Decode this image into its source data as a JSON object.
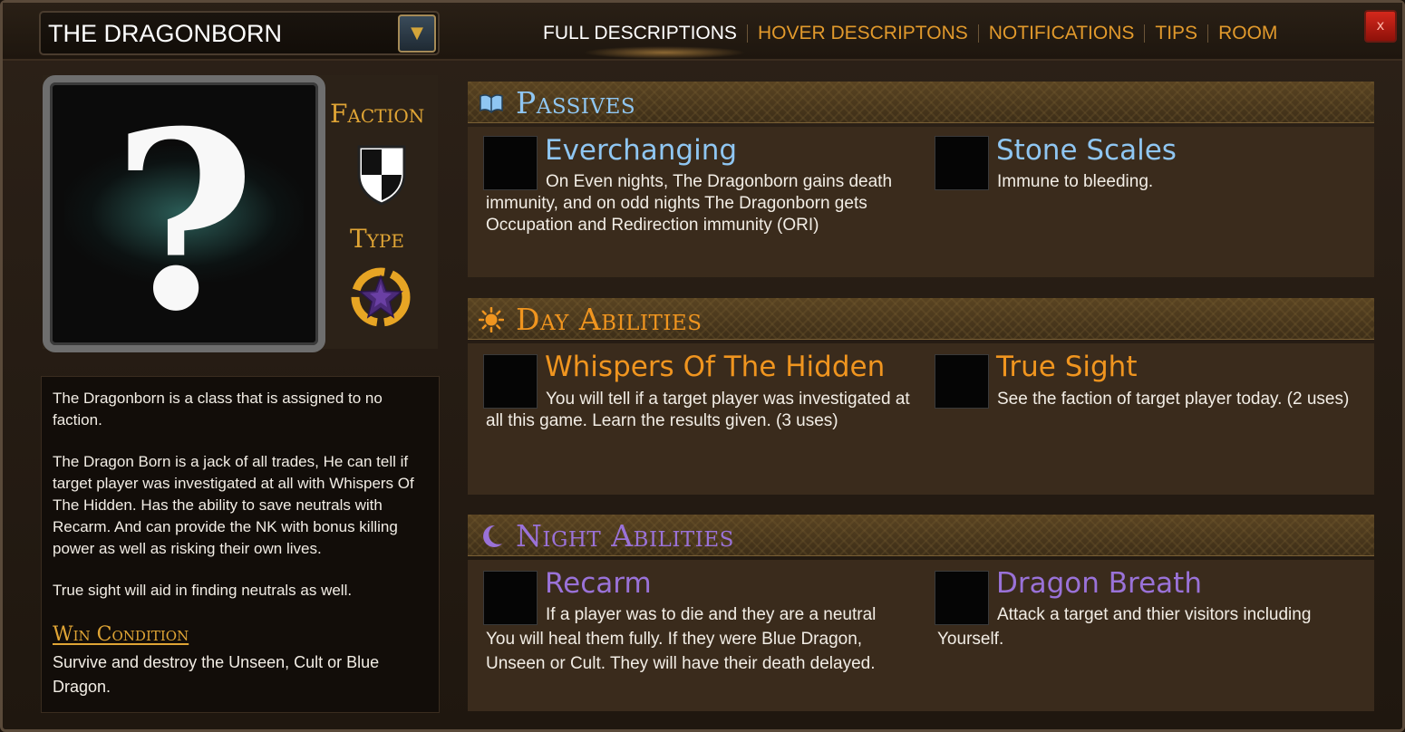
{
  "header": {
    "role_name": "THE DRAGONBORN",
    "dropdown_arrow": "▼",
    "tabs": [
      {
        "label": "FULL DESCRIPTIONS",
        "active": true
      },
      {
        "label": "HOVER DESCRIPTONS",
        "active": false
      },
      {
        "label": "NOTIFICATIONS",
        "active": false
      },
      {
        "label": "TIPS",
        "active": false
      },
      {
        "label": "ROOM",
        "active": false
      }
    ],
    "close_label": "x"
  },
  "portrait": {
    "symbol": "?"
  },
  "sidebar": {
    "faction_label": "Faction",
    "type_label": "Type",
    "faction_icon": "shield-checkered-icon",
    "type_icon": "purple-star-ring-icon"
  },
  "description": {
    "paragraphs": [
      "The Dragonborn is a class that is assigned to no faction.",
      "The Dragon Born is a jack of all trades, He can tell if target player was investigated at all with Whispers Of The Hidden. Has the ability to save neutrals with Recarm. And can provide the NK with bonus killing power as well as risking their own lives.",
      "True sight will aid in finding neutrals as well."
    ],
    "win_condition_title": "Win Condition",
    "win_condition_text": "Survive and destroy the Unseen, Cult or Blue Dragon."
  },
  "sections": {
    "passives": {
      "title": "Passives",
      "color": "#8fc6f2",
      "icon": "book-icon",
      "abilities": [
        {
          "name": "Everchanging",
          "desc": "On Even nights, The Dragonborn gains death immunity, and on odd nights The Dragonborn gets Occupation and Redirection immunity (ORI)"
        },
        {
          "name": "Stone Scales",
          "desc": "Immune to bleeding."
        }
      ]
    },
    "day": {
      "title": "Day Abilities",
      "color": "#f0951f",
      "icon": "sun-icon",
      "abilities": [
        {
          "name": "Whispers Of The Hidden",
          "desc": "You will tell if a target player was investigated at all this game. Learn the results given. (3 uses)"
        },
        {
          "name": "True Sight",
          "desc": "See the faction of target player today. (2 uses)"
        }
      ]
    },
    "night": {
      "title": "Night Abilities",
      "color": "#9a72d8",
      "icon": "moon-icon",
      "abilities": [
        {
          "name": "Recarm",
          "desc": "If a player was to die and they are a neutral You will heal them fully. If they were Blue Dragon, Unseen or Cult. They will have their death delayed."
        },
        {
          "name": "Dragon Breath",
          "desc": "Attack a target and thier visitors including Yourself."
        }
      ]
    }
  }
}
